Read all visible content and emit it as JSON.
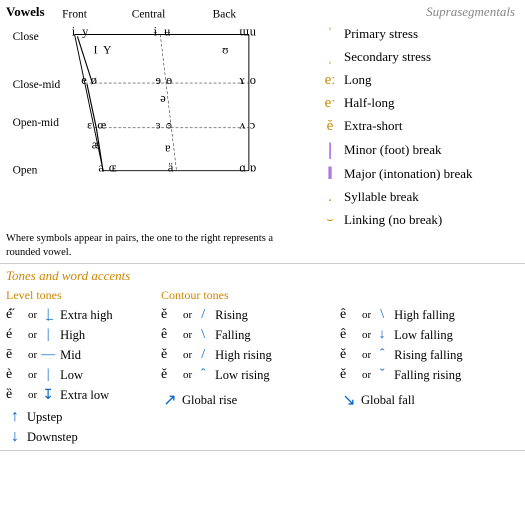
{
  "vowels": {
    "title": "Vowels",
    "columns": [
      "Front",
      "Central",
      "Back"
    ],
    "rows": [
      {
        "label": "Close",
        "y": 0
      },
      {
        "label": "Close-mid",
        "y": 1
      },
      {
        "label": "Open-mid",
        "y": 2
      },
      {
        "label": "Open",
        "y": 3
      }
    ],
    "note": "Where symbols appear in pairs, the one to the right represents a rounded vowel."
  },
  "suprasegmentals": {
    "title": "Suprasegmentals",
    "items": [
      {
        "symbol": "ˈ",
        "label": "Primary stress"
      },
      {
        "symbol": "ˌ",
        "label": "Secondary stress"
      },
      {
        "symbol": "eː",
        "label": "Long"
      },
      {
        "symbol": "eˑ",
        "label": "Half-long"
      },
      {
        "symbol": "ĕ",
        "label": "Extra-short"
      },
      {
        "symbol": "|",
        "label": "Minor (foot) break"
      },
      {
        "symbol": "‖",
        "label": "Major (intonation) break"
      },
      {
        "symbol": ".",
        "label": "Syllable break"
      },
      {
        "symbol": "‿",
        "label": "Linking (no break)"
      }
    ]
  },
  "tones": {
    "title": "Tones and word accents",
    "level_title": "Level tones",
    "contour_title": "Contour tones",
    "level_items": [
      {
        "letter": "é̋",
        "mark": "↥",
        "desc": "Extra high"
      },
      {
        "letter": "é",
        "mark": "↑",
        "desc": "High"
      },
      {
        "letter": "ē",
        "mark": "→",
        "desc": "Mid"
      },
      {
        "letter": "è",
        "mark": "↓",
        "desc": "Low"
      },
      {
        "letter": "ȅ",
        "mark": "↡",
        "desc": "Extra low"
      },
      {
        "letter": "↑",
        "mark": "",
        "desc": "Upstep",
        "no_letter": true
      },
      {
        "letter": "↓",
        "mark": "",
        "desc": "Downstep",
        "no_letter": true
      }
    ],
    "contour_col1": [
      {
        "letter": "ě",
        "mark": "↗",
        "desc": "Rising"
      },
      {
        "letter": "ê",
        "mark": "↘",
        "desc": "Falling"
      },
      {
        "letter": "ě̤",
        "mark": "↗↘",
        "desc": "High rising"
      },
      {
        "letter": "ě",
        "mark": "↙",
        "desc": "Low rising"
      }
    ],
    "contour_col2": [
      {
        "letter": "ê",
        "mark": "↘",
        "desc": "High falling"
      },
      {
        "letter": "ê̤",
        "mark": "↘",
        "desc": "Low falling"
      },
      {
        "letter": "ě̤",
        "mark": "↗↘",
        "desc": "Rising falling"
      },
      {
        "letter": "ě",
        "mark": "↘↗",
        "desc": "Falling rising"
      }
    ],
    "global_items": [
      {
        "symbol": "↗",
        "desc": "Global rise"
      },
      {
        "symbol": "↘",
        "desc": "Global fall"
      }
    ]
  }
}
